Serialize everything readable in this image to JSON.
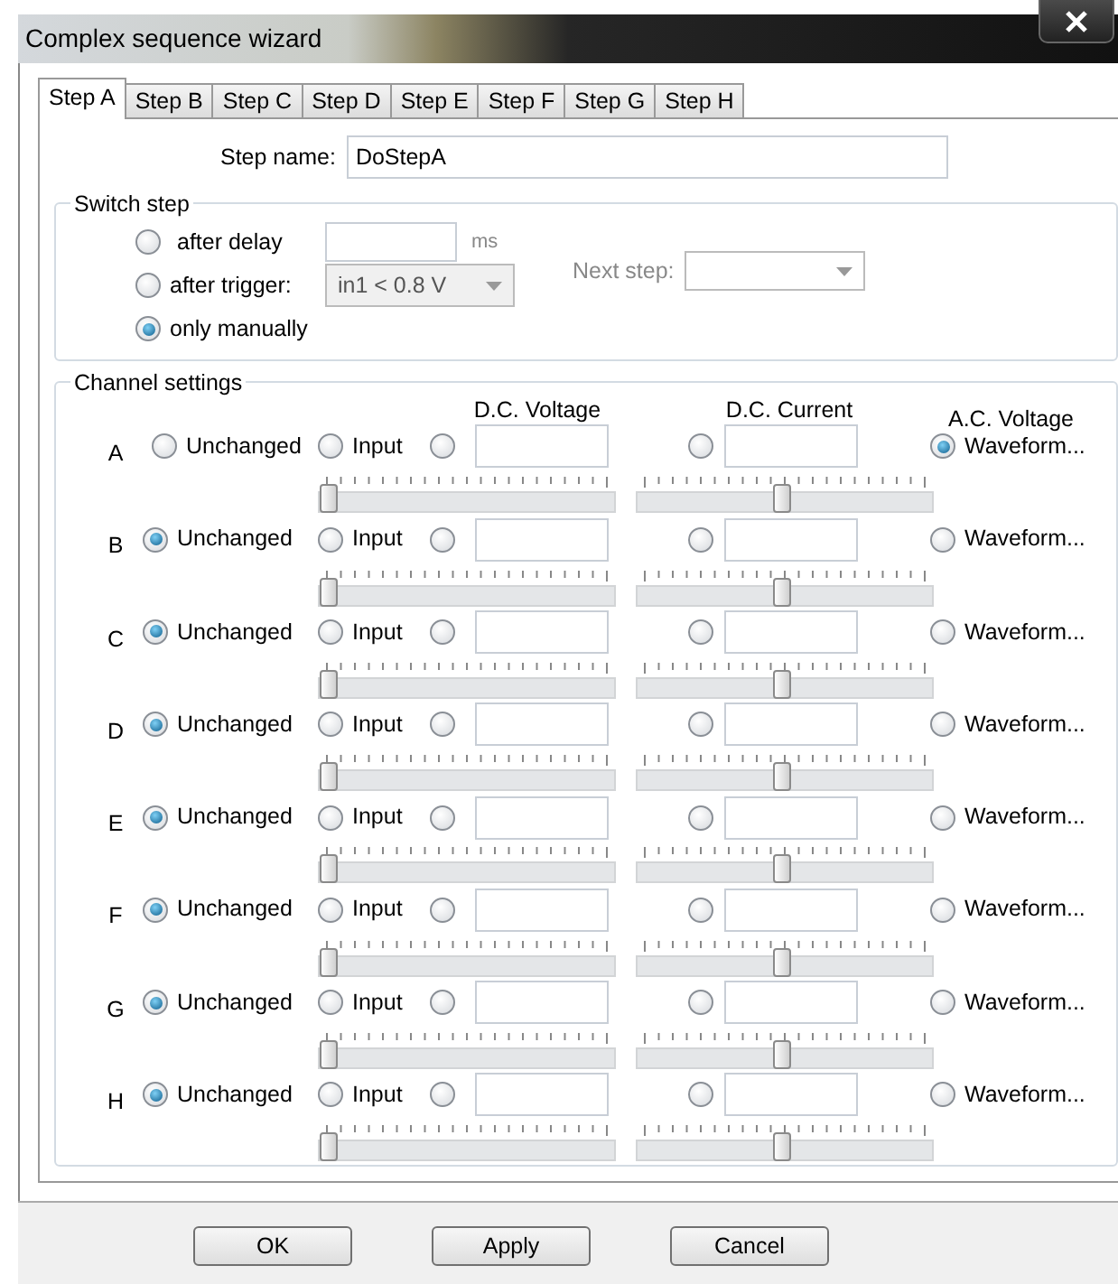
{
  "window": {
    "title": "Complex sequence wizard"
  },
  "tabs": [
    {
      "label": "Step A",
      "selected": true
    },
    {
      "label": "Step B",
      "selected": false
    },
    {
      "label": "Step C",
      "selected": false
    },
    {
      "label": "Step D",
      "selected": false
    },
    {
      "label": "Step E",
      "selected": false
    },
    {
      "label": "Step F",
      "selected": false
    },
    {
      "label": "Step G",
      "selected": false
    },
    {
      "label": "Step H",
      "selected": false
    }
  ],
  "step_name": {
    "label": "Step name:",
    "value": "DoStepA"
  },
  "switch_step": {
    "title": "Switch step",
    "options": [
      {
        "kind": "delay",
        "label": "after delay",
        "selected": false,
        "unit": "ms"
      },
      {
        "kind": "trigger",
        "label": "after trigger:",
        "selected": false,
        "dropdown": {
          "value": "in1 < 0.8 V",
          "disabled": true
        }
      },
      {
        "kind": "manual",
        "label": "only manually",
        "selected": true
      }
    ],
    "next_step": {
      "label": "Next step:",
      "disabled": true
    }
  },
  "channel_settings": {
    "title": "Channel settings",
    "columns": [
      "D.C. Voltage",
      "D.C. Current",
      "A.C. Voltage"
    ],
    "channels": [
      {
        "name": "A",
        "unchanged": {
          "label": "Unchanged",
          "selected": false
        },
        "input": {
          "label": "Input",
          "selected": false
        },
        "dc_voltage": {
          "selected": false,
          "slider": {
            "level": 0
          }
        },
        "dc_current": {
          "selected": false,
          "slider": {
            "level": 0.5
          }
        },
        "ac_voltage": {
          "label": "Waveform...",
          "selected": true
        }
      },
      {
        "name": "B",
        "unchanged": {
          "label": "Unchanged",
          "selected": true
        },
        "input": {
          "label": "Input",
          "selected": false
        },
        "dc_voltage": {
          "selected": false,
          "slider": {
            "level": 0
          }
        },
        "dc_current": {
          "selected": false,
          "slider": {
            "level": 0.5
          }
        },
        "ac_voltage": {
          "label": "Waveform...",
          "selected": false
        }
      },
      {
        "name": "C",
        "unchanged": {
          "label": "Unchanged",
          "selected": true
        },
        "input": {
          "label": "Input",
          "selected": false
        },
        "dc_voltage": {
          "selected": false,
          "slider": {
            "level": 0
          }
        },
        "dc_current": {
          "selected": false,
          "slider": {
            "level": 0.5
          }
        },
        "ac_voltage": {
          "label": "Waveform...",
          "selected": false
        }
      },
      {
        "name": "D",
        "unchanged": {
          "label": "Unchanged",
          "selected": true
        },
        "input": {
          "label": "Input",
          "selected": false
        },
        "dc_voltage": {
          "selected": false,
          "slider": {
            "level": 0
          }
        },
        "dc_current": {
          "selected": false,
          "slider": {
            "level": 0.5
          }
        },
        "ac_voltage": {
          "label": "Waveform...",
          "selected": false
        }
      },
      {
        "name": "E",
        "unchanged": {
          "label": "Unchanged",
          "selected": true
        },
        "input": {
          "label": "Input",
          "selected": false
        },
        "dc_voltage": {
          "selected": false,
          "slider": {
            "level": 0
          }
        },
        "dc_current": {
          "selected": false,
          "slider": {
            "level": 0.5
          }
        },
        "ac_voltage": {
          "label": "Waveform...",
          "selected": false
        }
      },
      {
        "name": "F",
        "unchanged": {
          "label": "Unchanged",
          "selected": true
        },
        "input": {
          "label": "Input",
          "selected": false
        },
        "dc_voltage": {
          "selected": false,
          "slider": {
            "level": 0
          }
        },
        "dc_current": {
          "selected": false,
          "slider": {
            "level": 0.5
          }
        },
        "ac_voltage": {
          "label": "Waveform...",
          "selected": false
        }
      },
      {
        "name": "G",
        "unchanged": {
          "label": "Unchanged",
          "selected": true
        },
        "input": {
          "label": "Input",
          "selected": false
        },
        "dc_voltage": {
          "selected": false,
          "slider": {
            "level": 0
          }
        },
        "dc_current": {
          "selected": false,
          "slider": {
            "level": 0.5
          }
        },
        "ac_voltage": {
          "label": "Waveform...",
          "selected": false
        }
      },
      {
        "name": "H",
        "unchanged": {
          "label": "Unchanged",
          "selected": true
        },
        "input": {
          "label": "Input",
          "selected": false
        },
        "dc_voltage": {
          "selected": false,
          "slider": {
            "level": 0
          }
        },
        "dc_current": {
          "selected": false,
          "slider": {
            "level": 0.5
          }
        },
        "ac_voltage": {
          "label": "Waveform...",
          "selected": false
        }
      }
    ]
  },
  "buttons": [
    "OK",
    "Apply",
    "Cancel"
  ]
}
